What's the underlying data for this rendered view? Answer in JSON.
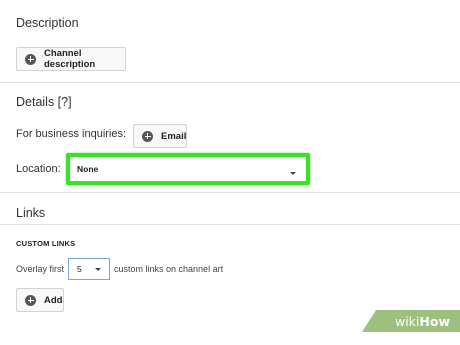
{
  "description": {
    "title": "Description",
    "channel_button_label": "Channel description"
  },
  "details": {
    "title": "Details [?]",
    "business_label": "For business inquiries:",
    "email_button_label": "Email",
    "location_label": "Location:",
    "location_value": "None"
  },
  "links": {
    "title": "Links",
    "custom_links_header": "CUSTOM LINKS",
    "overlay_prefix": "Overlay first",
    "overlay_count": "5",
    "overlay_suffix": "custom links on channel art",
    "add_button_label": "Add"
  },
  "watermark": {
    "wiki": "wiki",
    "how": "How"
  },
  "colors": {
    "highlight": "#39e229",
    "select_border": "#7aa7d8",
    "watermark_bg": "#9ec07f"
  }
}
